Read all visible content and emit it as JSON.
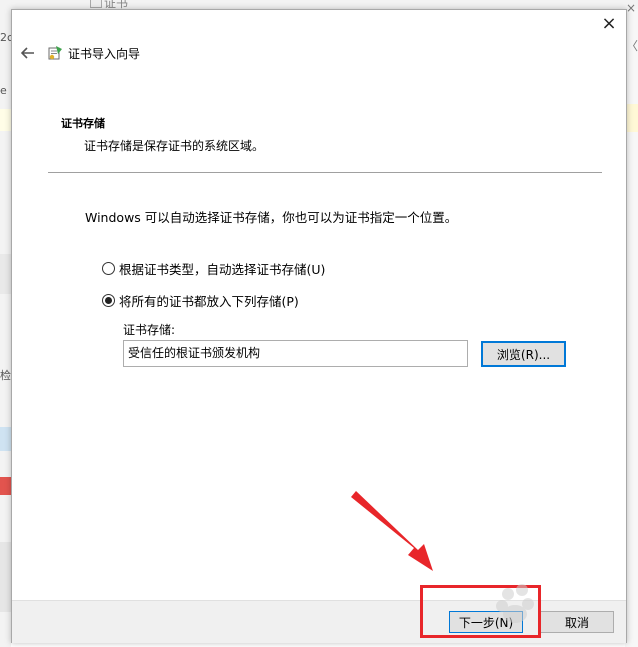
{
  "background": {
    "title_fragment": "证书",
    "left_fragments": [
      "2c",
      "e",
      "检"
    ],
    "right_fragments": [
      "×",
      "〈"
    ]
  },
  "dialog": {
    "close_glyph": "×",
    "wizard_title": "证书导入向导",
    "section": {
      "heading": "证书存储",
      "description": "证书存储是保存证书的系统区域。"
    },
    "intro_text": "Windows 可以自动选择证书存储，你也可以为证书指定一个位置。",
    "options": [
      {
        "label": "根据证书类型，自动选择证书存储(U)",
        "selected": false
      },
      {
        "label": "将所有的证书都放入下列存储(P)",
        "selected": true
      }
    ],
    "store": {
      "label": "证书存储:",
      "value": "受信任的根证书颁发机构",
      "browse_label": "浏览(R)..."
    },
    "footer": {
      "next_label": "下一步(N)",
      "cancel_label": "取消"
    }
  },
  "icons": {
    "back": "back-arrow-icon",
    "wizard": "certificate-wizard-icon",
    "close": "close-icon"
  },
  "colors": {
    "accent": "#0078d7",
    "annotation": "#e8262a"
  }
}
